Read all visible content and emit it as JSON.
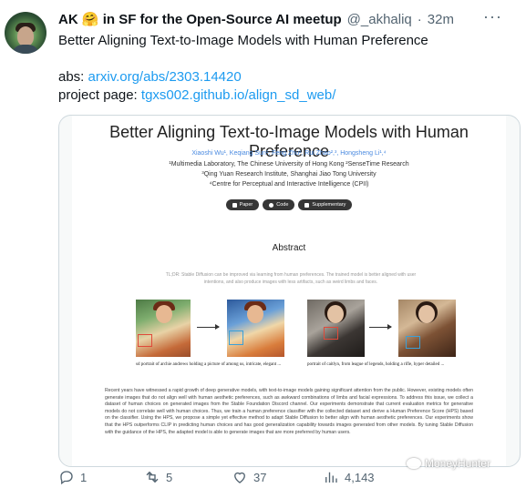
{
  "tweet": {
    "author_name": "AK",
    "author_emoji": "🤗",
    "author_suffix": "in SF for the Open-Source AI meetup",
    "handle": "@_akhaliq",
    "separator": "·",
    "time": "32m",
    "more_label": "···",
    "line1": "Better Aligning Text-to-Image Models with Human Preference",
    "abs_prefix": "abs: ",
    "abs_link": "arxiv.org/abs/2303.14420",
    "project_prefix": "project page: ",
    "project_link": "tgxs002.github.io/align_sd_web/"
  },
  "paper": {
    "title": "Better Aligning Text-to-Image Models with Human Preference",
    "authors": "Xiaoshi Wu¹, Keqiang Sun¹, Feng Zhu², Rui Zhao²,³, Hongsheng Li¹,⁴",
    "affil1": "¹Multimedia Laboratory, The Chinese University of Hong Kong ²SenseTime Research",
    "affil2": "³Qing Yuan Research Institute, Shanghai Jiao Tong University",
    "affil3": "⁴Centre for Perceptual and Interactive Intelligence (CPII)",
    "buttons": [
      "Paper",
      "Code",
      "Supplementary"
    ],
    "abstract_heading": "Abstract",
    "tldr": "TL;DR: Stable Diffusion can be improved via learning from human preferences. The trained model is better aligned with user intentions, and also produce images with less artifacts, such as weird limbs and faces.",
    "caption1": "sd portrait of archie andrews holding a picture of among us, intricate, elegant ...",
    "caption2": "portrait of caitlyn, from league of legends, holding a rifle, hyper detailed ...",
    "abstract_body": "Recent years have witnessed a rapid growth of deep generative models, with text-to-image models gaining significant attention from the public. However, existing models often generate images that do not align well with human aesthetic preferences, such as awkward combinations of limbs and facial expressions. To address this issue, we collect a dataset of human choices on generated images from the Stable Foundation Discord channel. Our experiments demonstrate that current evaluation metrics for generative models do not correlate well with human choices. Thus, we train a human preference classifier with the collected dataset and derive a Human Preference Score (HPS) based on the classifier. Using the HPS, we propose a simple yet effective method to adapt Stable Diffusion to better align with human aesthetic preferences. Our experiments show that the HPS outperforms CLIP in predicting human choices and has good generalization capability towards images generated from other models. By tuning Stable Diffusion with the guidance of the HPS, the adapted model is able to generate images that are more preferred by human users."
  },
  "watermark": "MoneyHunter",
  "actions": {
    "replies": "1",
    "retweets": "5",
    "likes": "37",
    "views": "4,143"
  },
  "icons": {
    "reply": "reply-icon",
    "retweet": "retweet-icon",
    "like": "heart-icon",
    "views": "views-icon"
  },
  "colors": {
    "link": "#1d9bf0",
    "muted": "#536471",
    "text": "#0f1419"
  }
}
